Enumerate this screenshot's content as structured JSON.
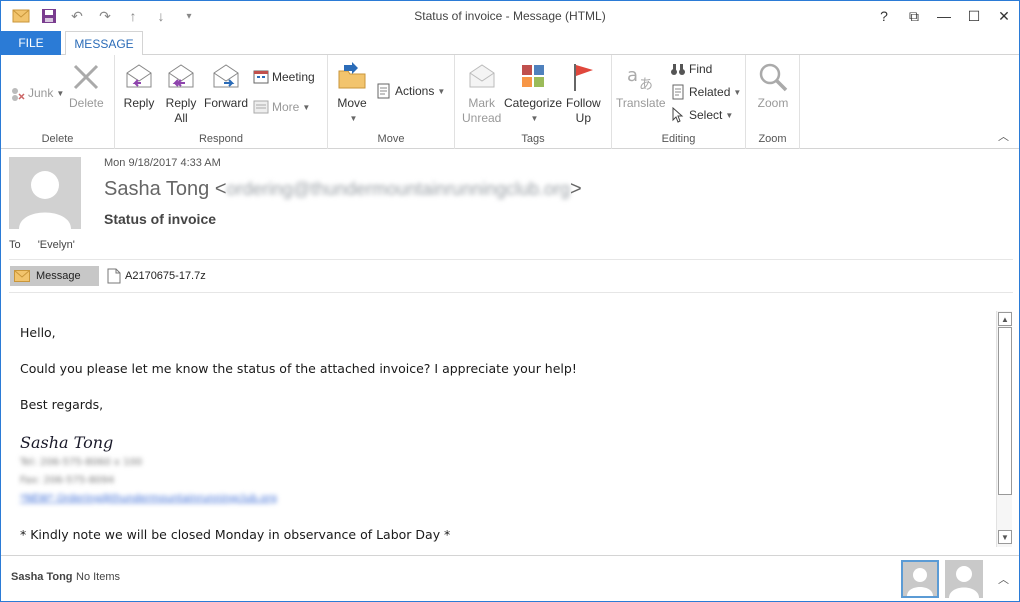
{
  "window": {
    "title": "Status of invoice - Message (HTML)",
    "controls": [
      "?",
      "⧉",
      "—",
      "☐",
      "✕"
    ]
  },
  "tabs": {
    "file": "FILE",
    "message": "MESSAGE"
  },
  "ribbon": {
    "delete_group": {
      "label": "Delete",
      "junk": "Junk",
      "delete": "Delete"
    },
    "respond_group": {
      "label": "Respond",
      "reply": "Reply",
      "reply_all_1": "Reply",
      "reply_all_2": "All",
      "forward": "Forward",
      "meeting": "Meeting",
      "more": "More"
    },
    "move_group": {
      "label": "Move",
      "move": "Move",
      "actions": "Actions"
    },
    "tags_group": {
      "label": "Tags",
      "mark_1": "Mark",
      "mark_2": "Unread",
      "categorize": "Categorize",
      "follow_1": "Follow",
      "follow_2": "Up"
    },
    "editing_group": {
      "label": "Editing",
      "translate": "Translate",
      "find": "Find",
      "related": "Related",
      "select": "Select"
    },
    "zoom_group": {
      "label": "Zoom",
      "zoom": "Zoom"
    }
  },
  "message": {
    "datetime": "Mon 9/18/2017 4:33 AM",
    "sender_name": "Sasha Tong",
    "sender_email": "ordering@thundermountainrunningclub.org",
    "subject": "Status of invoice",
    "to_label": "To",
    "to_value": "'Evelyn'"
  },
  "attachments": {
    "message_label": "Message",
    "file_name": "A2170675-17.7z"
  },
  "body": {
    "greeting": "Hello,",
    "line1": "Could you please let me know the status of the attached invoice? I appreciate your help!",
    "closing": "Best regards,",
    "signature": "Sasha Tong",
    "tel": "Tel: 206-575-8060 x 100",
    "fax": "Fax: 206-575-8094",
    "email_line": "*NEW* Ordering@thundermountainrunningclub.org",
    "note": "* Kindly note we will be closed Monday in observance of Labor Day *"
  },
  "people_pane": {
    "name": "Sasha Tong",
    "items": "No Items"
  },
  "colors": {
    "accent": "#2b7bd6",
    "file_tab": "#2b7bd6",
    "selected_border": "#5b9bd5"
  }
}
